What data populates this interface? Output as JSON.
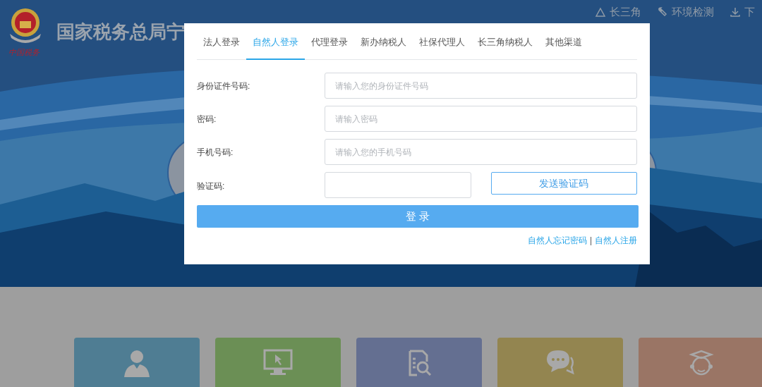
{
  "header": {
    "title": "国家税务总局宁",
    "logo_text": "中国税务",
    "links": [
      {
        "kind": "triangle",
        "label": "长三角"
      },
      {
        "kind": "wrench",
        "label": "环境检测"
      },
      {
        "kind": "download",
        "label": "下"
      }
    ]
  },
  "login": {
    "tabs": [
      {
        "label": "法人登录",
        "selected": false
      },
      {
        "label": "自然人登录",
        "selected": true
      },
      {
        "label": "代理登录",
        "selected": false
      },
      {
        "label": "新办纳税人",
        "selected": false
      },
      {
        "label": "社保代理人",
        "selected": false
      },
      {
        "label": "长三角纳税人",
        "selected": false
      },
      {
        "label": "其他渠道",
        "selected": false
      }
    ],
    "fields": [
      {
        "label": "身份证件号码:",
        "placeholder": "请输入您的身份证件号码"
      },
      {
        "label": "密码:",
        "placeholder": "请输入密码"
      },
      {
        "label": "手机号码:",
        "placeholder": "请输入您的手机号码"
      }
    ],
    "captcha": {
      "label": "验证码:",
      "button": "发送验证码"
    },
    "submit": "登 录",
    "links": [
      "自然人忘记密码",
      "自然人注册"
    ],
    "separator": "|"
  },
  "cards": [
    {
      "kind": "person",
      "color": "#4f7d93"
    },
    {
      "kind": "monitor",
      "color": "#6b8f55"
    },
    {
      "kind": "doc-search",
      "color": "#646f91"
    },
    {
      "kind": "chat",
      "color": "#938550"
    },
    {
      "kind": "graduate",
      "color": "#9a7565"
    }
  ]
}
